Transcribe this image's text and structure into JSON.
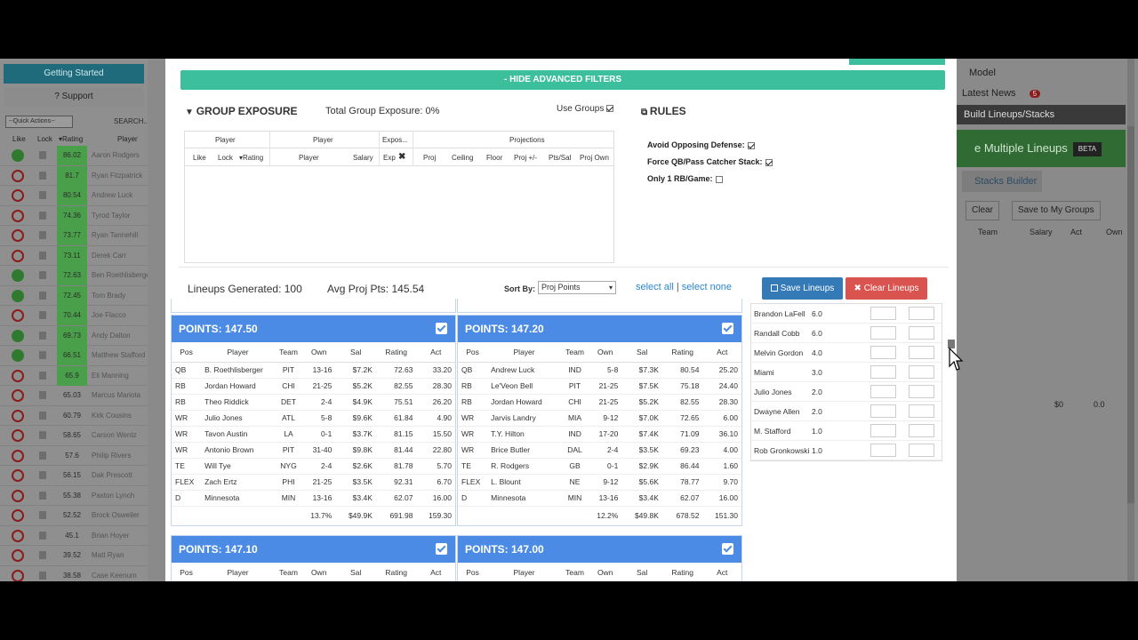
{
  "background": {
    "getting_started": "Getting Started",
    "support": "? Support",
    "quick_actions": "--Quick Actions--",
    "search": "SEARCH...",
    "cols": {
      "like": "Like",
      "lock": "Lock",
      "rating": "▾Rating",
      "player": "Player"
    },
    "rows": [
      {
        "s": "like",
        "r": "86.02",
        "n": "Aaron Rodgers"
      },
      {
        "s": "no",
        "r": "81.7",
        "n": "Ryan Fitzpatrick"
      },
      {
        "s": "no",
        "r": "80.54",
        "n": "Andrew Luck"
      },
      {
        "s": "no",
        "r": "74.36",
        "n": "Tyrod Taylor"
      },
      {
        "s": "no",
        "r": "73.77",
        "n": "Ryan Tannehill"
      },
      {
        "s": "no",
        "r": "73.11",
        "n": "Derek Carr"
      },
      {
        "s": "like",
        "r": "72.63",
        "n": "Ben Roethlisberger"
      },
      {
        "s": "like",
        "r": "72.45",
        "n": "Tom Brady"
      },
      {
        "s": "no",
        "r": "70.44",
        "n": "Joe Flacco"
      },
      {
        "s": "like",
        "r": "69.73",
        "n": "Andy Dalton"
      },
      {
        "s": "like",
        "r": "66.51",
        "n": "Matthew Stafford"
      },
      {
        "s": "no",
        "r": "65.9",
        "n": "Eli Manning"
      },
      {
        "s": "no",
        "r": "65.03",
        "n": "Marcus Mariota"
      },
      {
        "s": "no",
        "r": "60.79",
        "n": "Kirk Cousins"
      },
      {
        "s": "no",
        "r": "58.65",
        "n": "Carson Wentz"
      },
      {
        "s": "no",
        "r": "57.6",
        "n": "Philip Rivers"
      },
      {
        "s": "no",
        "r": "56.15",
        "n": "Dak Prescott"
      },
      {
        "s": "no",
        "r": "55.38",
        "n": "Paxton Lynch"
      },
      {
        "s": "no",
        "r": "52.52",
        "n": "Brock Osweiler"
      },
      {
        "s": "no",
        "r": "45.1",
        "n": "Brian Hoyer"
      },
      {
        "s": "no",
        "r": "39.52",
        "n": "Matt Ryan"
      },
      {
        "s": "no",
        "r": "38.58",
        "n": "Case Keenum"
      }
    ],
    "right": {
      "model": "Model",
      "news": "Latest News",
      "news_count": "5",
      "build": "Build Lineups/Stacks",
      "multi": "e Multiple Lineups",
      "beta": "BETA",
      "stacks": "Stacks Builder",
      "clear": "Clear",
      "save_groups": "Save to My Groups",
      "team": "Team",
      "salary": "Salary",
      "act": "Act",
      "own": "Own",
      "zero_sal": "$0",
      "zero_act": "0.0"
    }
  },
  "modal": {
    "hide_filters": "- HIDE ADVANCED FILTERS",
    "group_exposure": "GROUP EXPOSURE",
    "total_group_exposure": "Total Group Exposure: 0%",
    "use_groups": "Use Groups",
    "ge_table": {
      "h1": [
        "Player",
        "Player",
        "Expos...",
        "Projections"
      ],
      "h2": [
        "Like",
        "Lock",
        "▾Rating",
        "Player",
        "Salary",
        "Exp",
        "Proj",
        "Ceiling",
        "Floor",
        "Proj +/-",
        "Pts/Sal",
        "Proj Own"
      ]
    },
    "rules_title": "RULES",
    "rules": [
      "Avoid Opposing Defense:",
      "Force QB/Pass Catcher Stack:",
      "Only 1 RB/Game:"
    ],
    "lineups_generated": "Lineups Generated: 100",
    "avg_proj": "Avg Proj Pts: 145.54",
    "sort_by": "Sort By:",
    "sort_value": "Proj Points",
    "select_all": "select all",
    "select_none": "select none",
    "save_lineups": "Save Lineups",
    "clear_lineups": "Clear Lineups"
  },
  "table_headers": [
    "Pos",
    "Player",
    "Team",
    "Own",
    "Sal",
    "Rating",
    "Act"
  ],
  "lineups": [
    {
      "title": "POINTS: 147.50",
      "rows": [
        [
          "QB",
          "B. Roethlisberger",
          "PIT",
          "13-16",
          "$7.2K",
          "72.63",
          "33.20"
        ],
        [
          "RB",
          "Jordan Howard",
          "CHI",
          "21-25",
          "$5.2K",
          "82.55",
          "28.30"
        ],
        [
          "RB",
          "Theo Riddick",
          "DET",
          "2-4",
          "$4.9K",
          "75.51",
          "26.20"
        ],
        [
          "WR",
          "Julio Jones",
          "ATL",
          "5-8",
          "$9.6K",
          "61.84",
          "4.90"
        ],
        [
          "WR",
          "Tavon Austin",
          "LA",
          "0-1",
          "$3.7K",
          "81.15",
          "15.50"
        ],
        [
          "WR",
          "Antonio Brown",
          "PIT",
          "31-40",
          "$9.8K",
          "81.44",
          "22.80"
        ],
        [
          "TE",
          "Will Tye",
          "NYG",
          "2-4",
          "$2.6K",
          "81.78",
          "5.70"
        ],
        [
          "FLEX",
          "Zach Ertz",
          "PHI",
          "21-25",
          "$3.5K",
          "92.31",
          "6.70"
        ],
        [
          "D",
          "Minnesota",
          "MIN",
          "13-16",
          "$3.4K",
          "62.07",
          "16.00"
        ]
      ],
      "totals": [
        "13.7%",
        "$49.9K",
        "691.98",
        "159.30"
      ]
    },
    {
      "title": "POINTS: 147.20",
      "rows": [
        [
          "QB",
          "Andrew Luck",
          "IND",
          "5-8",
          "$7.3K",
          "80.54",
          "25.20"
        ],
        [
          "RB",
          "Le'Veon Bell",
          "PIT",
          "21-25",
          "$7.5K",
          "75.18",
          "24.40"
        ],
        [
          "RB",
          "Jordan Howard",
          "CHI",
          "21-25",
          "$5.2K",
          "82.55",
          "28.30"
        ],
        [
          "WR",
          "Jarvis Landry",
          "MIA",
          "9-12",
          "$7.0K",
          "72.65",
          "6.00"
        ],
        [
          "WR",
          "T.Y. Hilton",
          "IND",
          "17-20",
          "$7.4K",
          "71.09",
          "36.10"
        ],
        [
          "WR",
          "Brice Butler",
          "DAL",
          "2-4",
          "$3.5K",
          "69.23",
          "4.00"
        ],
        [
          "TE",
          "R. Rodgers",
          "GB",
          "0-1",
          "$2.9K",
          "86.44",
          "1.60"
        ],
        [
          "FLEX",
          "L. Blount",
          "NE",
          "9-12",
          "$5.6K",
          "78.77",
          "9.70"
        ],
        [
          "D",
          "Minnesota",
          "MIN",
          "13-16",
          "$3.4K",
          "62.07",
          "16.00"
        ]
      ],
      "totals": [
        "12.2%",
        "$49.8K",
        "678.52",
        "151.30"
      ]
    },
    {
      "title": "POINTS: 147.10",
      "rows": [],
      "totals": []
    },
    {
      "title": "POINTS: 147.00",
      "rows": [],
      "totals": []
    }
  ],
  "exposure": [
    {
      "n": "Brandon LaFell",
      "v": "6.0"
    },
    {
      "n": "Randall Cobb",
      "v": "6.0"
    },
    {
      "n": "Melvin Gordon",
      "v": "4.0"
    },
    {
      "n": "Miami",
      "v": "3.0"
    },
    {
      "n": "Julio Jones",
      "v": "2.0"
    },
    {
      "n": "Dwayne Allen",
      "v": "2.0"
    },
    {
      "n": "M. Stafford",
      "v": "1.0"
    },
    {
      "n": "Rob Gronkowski",
      "v": "1.0"
    }
  ]
}
